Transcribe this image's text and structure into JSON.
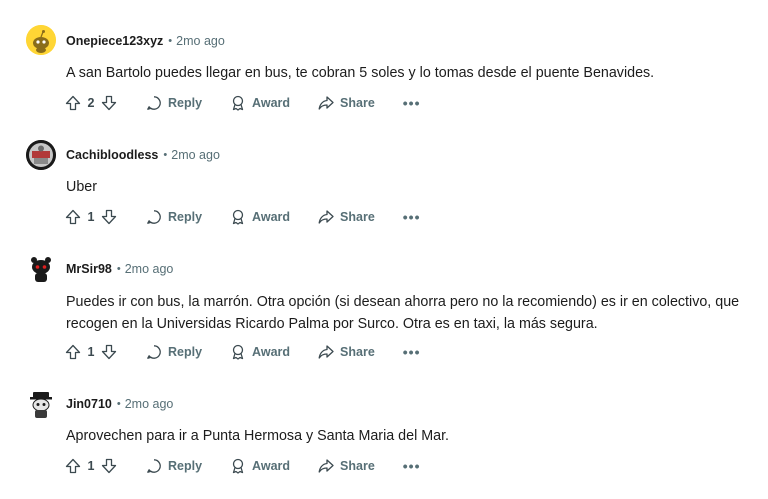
{
  "labels": {
    "reply": "Reply",
    "award": "Award",
    "share": "Share",
    "more": "•••",
    "separator": "•"
  },
  "icons": {
    "upvote": "upvote-arrow-icon",
    "downvote": "downvote-arrow-icon",
    "reply": "speech-bubble-icon",
    "award": "award-ribbon-icon",
    "share": "share-arrow-icon"
  },
  "colors": {
    "meta": "#576f76",
    "text": "#1c1c1c",
    "avatar_yellow": "#ffd635"
  },
  "comments": [
    {
      "username": "Onepiece123xyz",
      "time": "2mo ago",
      "body": "A san Bartolo puedes llegar en bus, te cobran 5 soles y lo tomas desde el puente Benavides.",
      "score": "2"
    },
    {
      "username": "Cachibloodless",
      "time": "2mo ago",
      "body": "Uber",
      "score": "1"
    },
    {
      "username": "MrSir98",
      "time": "2mo ago",
      "body": "Puedes ir con bus, la marrón. Otra opción (si desean ahorra pero no la recomiendo) es ir en colectivo, que recogen en la Universidas Ricardo Palma por Surco. Otra es en taxi, la más segura.",
      "score": "1"
    },
    {
      "username": "Jin0710",
      "time": "2mo ago",
      "body": "Aprovechen para ir a Punta Hermosa y Santa Maria del Mar.",
      "score": "1"
    }
  ]
}
